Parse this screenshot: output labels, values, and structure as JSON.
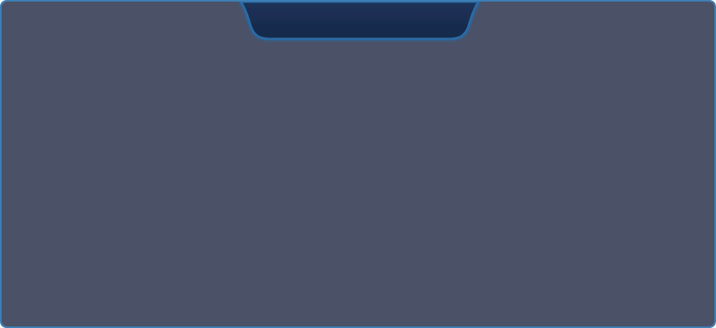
{
  "panel": {
    "title": ""
  },
  "colors": {
    "panel_fill": "#4b5167",
    "border_glow": "#3d7fb3",
    "notch_fill": "#1b2c4e",
    "notch_edge": "#2a5d93"
  }
}
